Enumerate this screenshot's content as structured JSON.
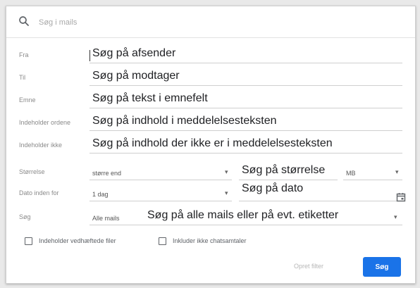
{
  "search": {
    "placeholder": "Søg i mails"
  },
  "fields": {
    "from": {
      "label": "Fra",
      "text": "Søg på afsender"
    },
    "to": {
      "label": "Til",
      "text": "Søg på modtager"
    },
    "subject": {
      "label": "Emne",
      "text": "Søg på tekst i emnefelt"
    },
    "has_words": {
      "label": "Indeholder ordene",
      "text": "Søg på indhold i meddelelsesteksten"
    },
    "no_words": {
      "label": "Indeholder ikke",
      "text": "Søg på indhold der ikke er i meddelelsesteksten"
    }
  },
  "size": {
    "label": "Størrelse",
    "operator": "større end",
    "text": "Søg på størrelse",
    "unit": "MB"
  },
  "date": {
    "label": "Dato inden for",
    "range": "1 dag",
    "text": "Søg på dato"
  },
  "search_in": {
    "label": "Søg",
    "value": "Alle mails",
    "text": "Søg på alle mails eller på evt. etiketter"
  },
  "checkboxes": {
    "attachments": "Indeholder vedhæftede filer",
    "no_chats": "Inkluder ikke chatsamtaler"
  },
  "actions": {
    "create_filter": "Opret filter",
    "search": "Søg"
  },
  "icons": {
    "search": "search-icon",
    "calendar": "calendar-icon",
    "dropdown": "dropdown-arrow-icon"
  },
  "colors": {
    "accent": "#1a73e8"
  }
}
